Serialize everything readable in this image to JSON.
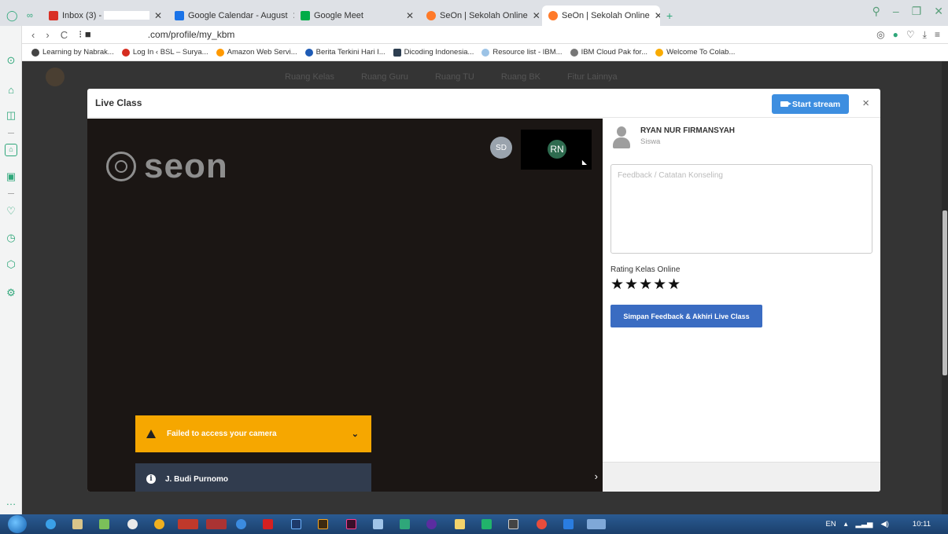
{
  "browser": {
    "tabs": [
      {
        "label": "Inbox (3) -",
        "color": "#d93025"
      },
      {
        "label": "Google Calendar - August",
        "color": "#1a73e8"
      },
      {
        "label": "Google Meet",
        "color": "#00ac47"
      },
      {
        "label": "SeOn | Sekolah Online",
        "color": "#ff7a29"
      },
      {
        "label": "SeOn | Sekolah Online",
        "color": "#ff7a29"
      }
    ],
    "new_tab": "+",
    "address": ".com/profile/my_kbm",
    "bookmarks": [
      "Learning by Nabrak...",
      "Log In ‹ BSL – Surya...",
      "Amazon Web Servi...",
      "Berita Terkini Hari I...",
      "Dicoding Indonesia...",
      "Resource list - IBM...",
      "IBM Cloud Pak for...",
      "Welcome To Colab..."
    ]
  },
  "page": {
    "nav": [
      "Ruang Kelas",
      "Ruang Guru",
      "Ruang TU",
      "Ruang BK",
      "Fitur Lainnya"
    ]
  },
  "modal": {
    "title": "Live Class",
    "start_stream": "Start stream",
    "close": "×",
    "video": {
      "logo_text": "seon",
      "participant_sd": "SD",
      "participant_rn": "RN",
      "warning": "Failed to access your camera",
      "speaker": "J. Budi Purnomo"
    },
    "panel": {
      "user_name": "RYAN NUR FIRMANSYAH",
      "user_role": "Siswa",
      "feedback_placeholder": "Feedback / Catatan Konseling",
      "rating_label": "Rating Kelas Online",
      "stars": "★★★★★",
      "submit": "Simpan Feedback & Akhiri Live Class"
    }
  },
  "taskbar": {
    "lang": "EN",
    "time": "10:11"
  }
}
